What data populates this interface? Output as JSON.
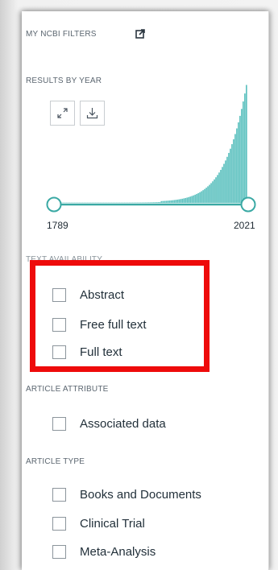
{
  "filters": {
    "my_ncbi_filters_label": "MY NCBI FILTERS",
    "external_link_icon": "external-link-icon"
  },
  "results_by_year": {
    "title": "RESULTS BY YEAR",
    "expand_icon": "expand-icon",
    "download_icon": "download-icon",
    "start_year": "1789",
    "end_year": "2021",
    "accent_color": "#5fc2c0"
  },
  "text_availability": {
    "title": "TEXT AVAILABILITY",
    "options": [
      {
        "label": "Abstract",
        "checked": false
      },
      {
        "label": "Free full text",
        "checked": false
      },
      {
        "label": "Full text",
        "checked": false
      }
    ],
    "highlight_color": "#ee0b0b"
  },
  "article_attribute": {
    "title": "ARTICLE ATTRIBUTE",
    "options": [
      {
        "label": "Associated data",
        "checked": false
      }
    ]
  },
  "article_type": {
    "title": "ARTICLE TYPE",
    "options": [
      {
        "label": "Books and Documents",
        "checked": false
      },
      {
        "label": "Clinical Trial",
        "checked": false
      },
      {
        "label": "Meta-Analysis",
        "checked": false
      }
    ]
  }
}
